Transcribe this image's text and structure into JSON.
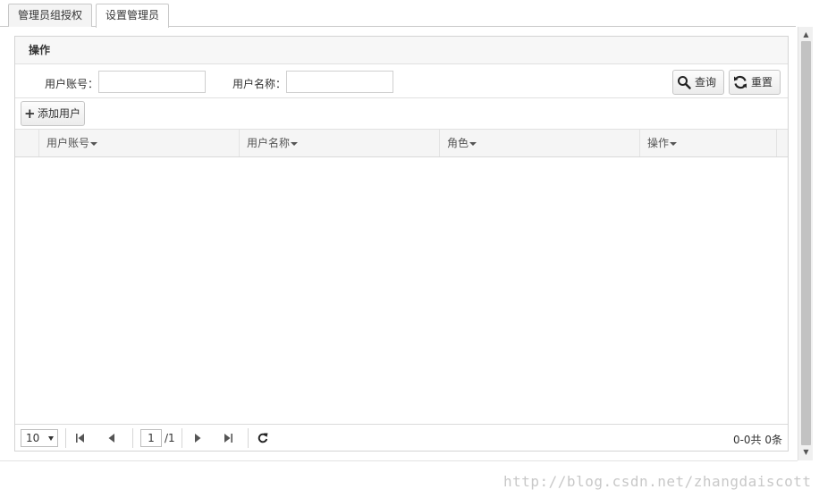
{
  "tabs": [
    {
      "label": "管理员组授权"
    },
    {
      "label": "设置管理员"
    }
  ],
  "panel": {
    "title": "操作"
  },
  "search": {
    "account_label": "用户账号：",
    "account_value": "",
    "name_label": "用户名称：",
    "name_value": "",
    "query_label": "查询",
    "reset_label": "重置"
  },
  "toolbar": {
    "add_label": "添加用户"
  },
  "grid": {
    "columns": [
      "用户账号",
      "用户名称",
      "角色",
      "操作"
    ],
    "rows": []
  },
  "pager": {
    "page_size": "10",
    "current_page": "1",
    "total_pages": "/1",
    "info": "0-0共 0条"
  },
  "watermark": "http://blog.csdn.net/zhangdaiscott"
}
